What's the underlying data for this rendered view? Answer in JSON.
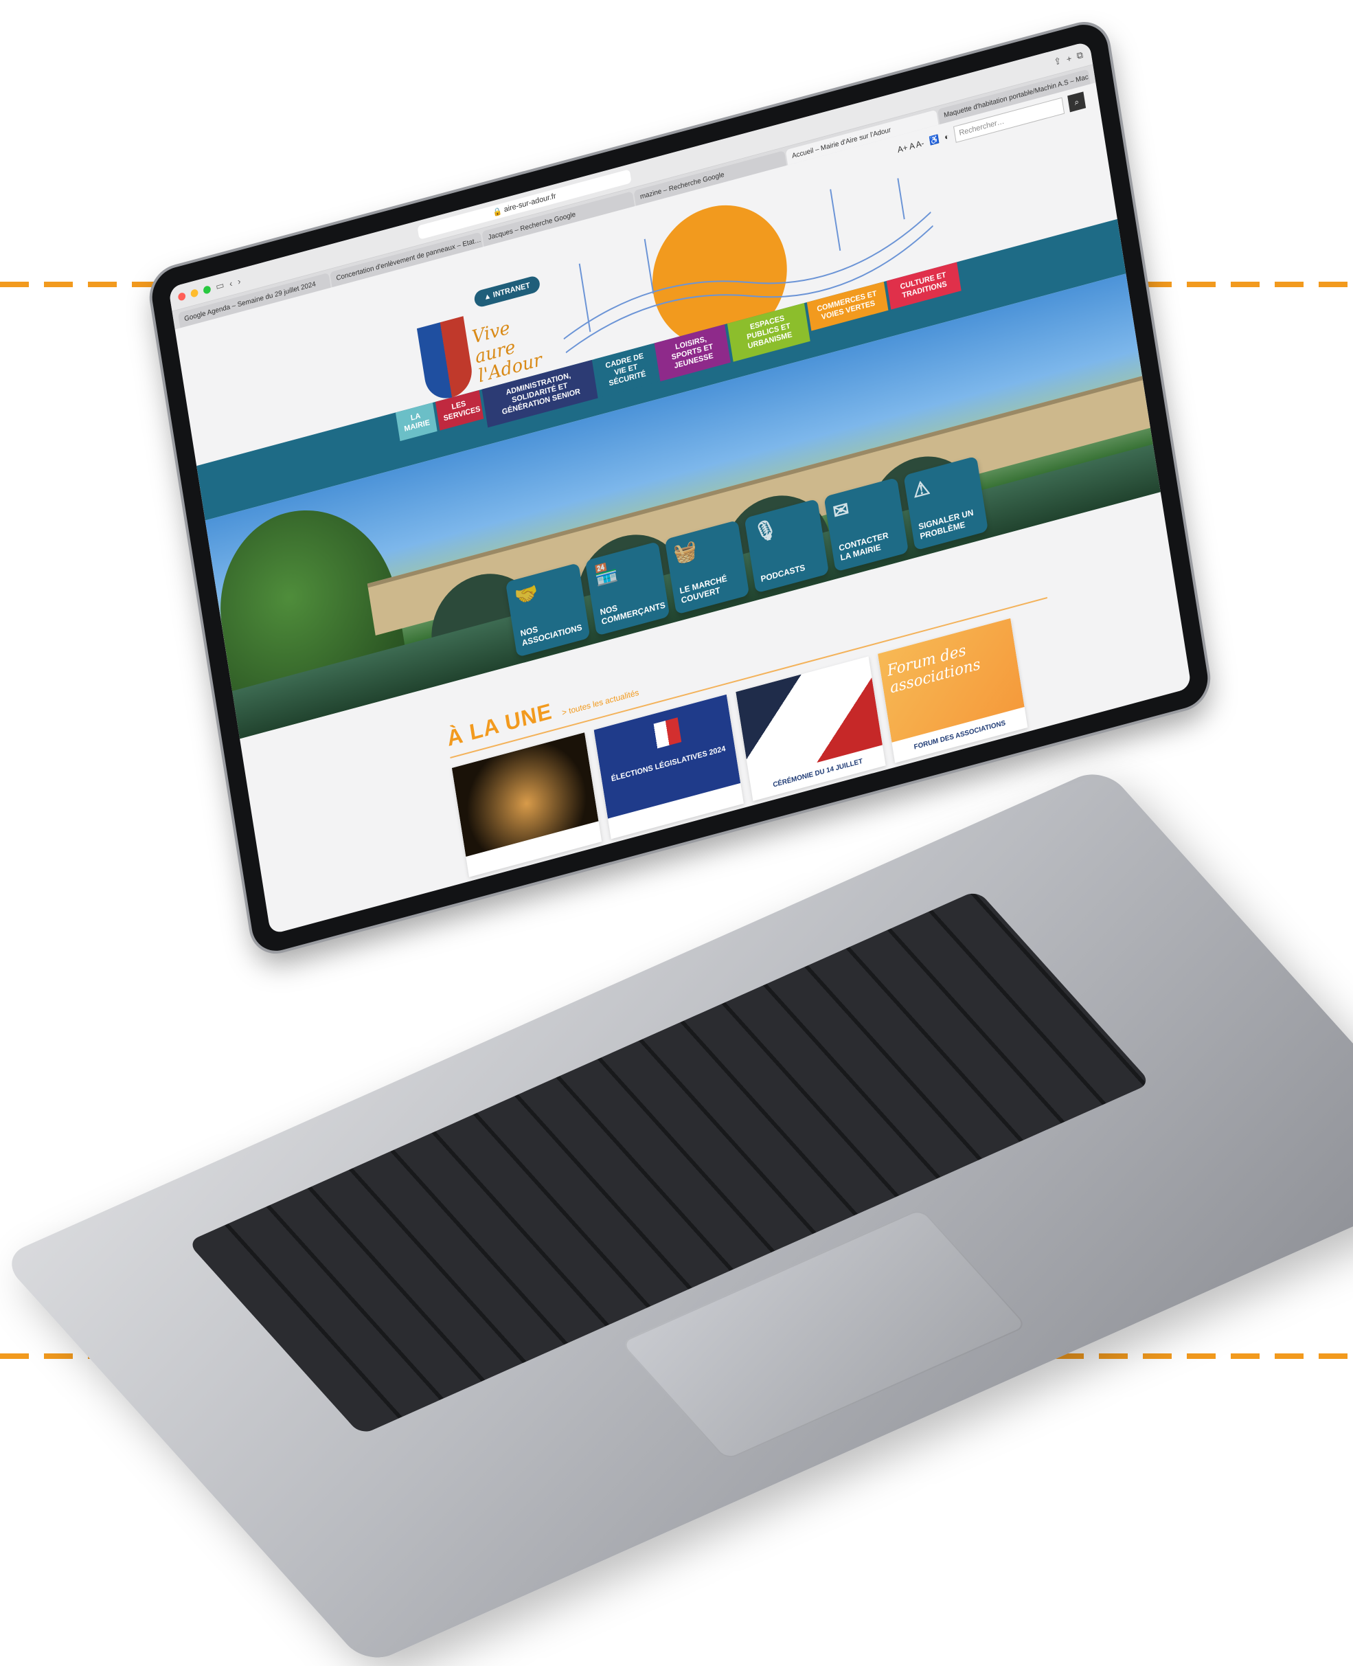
{
  "browser": {
    "url": "aire-sur-adour.fr",
    "tabs": [
      "Google Agenda – Semaine du 29 juillet 2024",
      "Concertation d'enlèvement de panneaux – Etat…",
      "Jacques – Recherche Google",
      "mazine – Recherche Google",
      "Accueil – Mairie d'Aire sur l'Adour",
      "Maquette d'habitation portable/Machin A.S – Mac"
    ],
    "active_tab": 4
  },
  "site": {
    "utility": {
      "font_sizes": "A+ A A-",
      "search_placeholder": "Rechercher…",
      "search_icon": "search-icon"
    },
    "intranet_label": "INTRANET",
    "logo_text": "Vive\naure\nl'Adour",
    "nav": [
      "La Mairie",
      "Les Services",
      "Administration, Solidarité et Génération Senior",
      "Cadre de vie et sécurité",
      "Loisirs, Sports et Jeunesse",
      "Espaces Publics et Urbanisme",
      "Commerces et voies vertes",
      "Culture et Traditions"
    ],
    "tiles": [
      {
        "label": "Nos associations",
        "icon": "handshake-icon"
      },
      {
        "label": "Nos commerçants",
        "icon": "shop-icon"
      },
      {
        "label": "Le marché couvert",
        "icon": "basket-icon"
      },
      {
        "label": "Podcasts",
        "icon": "microphone-icon"
      },
      {
        "label": "Contacter la mairie",
        "icon": "envelope-icon"
      },
      {
        "label": "Signaler un problème",
        "icon": "warning-icon"
      }
    ],
    "news": {
      "title": "À LA UNE",
      "link": "> toutes les actualités",
      "cards": [
        {
          "caption": "",
          "image": "church-night"
        },
        {
          "caption": "",
          "image": "elections",
          "overlay": "ÉLECTIONS LÉGISLATIVES 2024"
        },
        {
          "caption": "Cérémonie du 14 juillet",
          "image": "ceremony-poster"
        },
        {
          "caption": "Forum des associations",
          "image": "forum-poster",
          "overlay": "Forum des associations"
        }
      ]
    }
  },
  "colors": {
    "accent": "#f29a1e",
    "nav_blue": "#1e6b86",
    "dashed_line": "#f29a1e"
  }
}
